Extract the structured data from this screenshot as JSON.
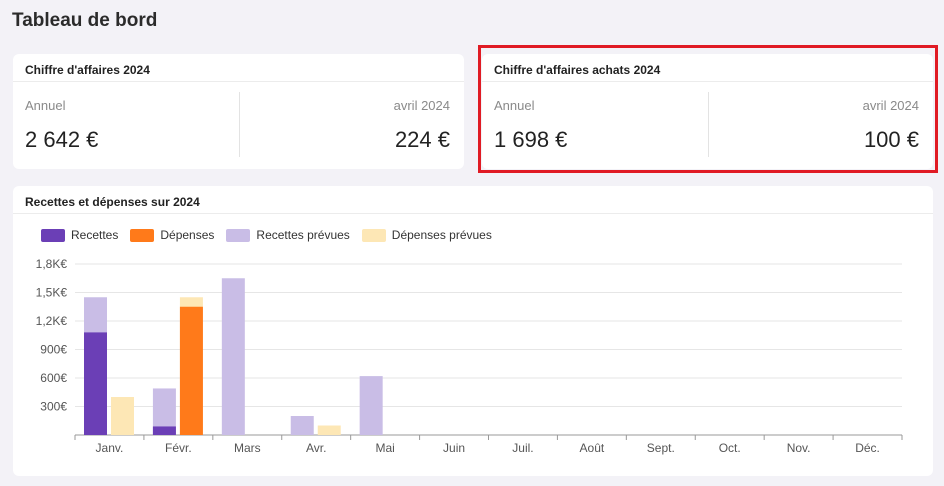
{
  "page": {
    "title": "Tableau de bord"
  },
  "revenue_card": {
    "title": "Chiffre d'affaires 2024",
    "annual_label": "Annuel",
    "annual_value": "2 642 €",
    "month_label": "avril 2024",
    "month_value": "224 €"
  },
  "purchases_card": {
    "title": "Chiffre d'affaires achats 2024",
    "annual_label": "Annuel",
    "annual_value": "1 698 €",
    "month_label": "avril 2024",
    "month_value": "100 €"
  },
  "chart_card": {
    "title": "Recettes et dépenses sur 2024"
  },
  "colors": {
    "recettes": "#6b3fb6",
    "depenses": "#ff7a1a",
    "recettes_prevues": "#c9bde6",
    "depenses_prevues": "#fde7b5",
    "highlight": "#e01b24"
  },
  "chart_data": {
    "type": "bar",
    "title": "Recettes et dépenses sur 2024",
    "categories": [
      "Janv.",
      "Févr.",
      "Mars",
      "Avr.",
      "Mai",
      "Juin",
      "Juil.",
      "Août",
      "Sept.",
      "Oct.",
      "Nov.",
      "Déc."
    ],
    "series": [
      {
        "name": "Recettes",
        "values": [
          1080,
          90,
          0,
          0,
          0,
          0,
          0,
          0,
          0,
          0,
          0,
          0
        ]
      },
      {
        "name": "Dépenses",
        "values": [
          0,
          1350,
          0,
          0,
          0,
          0,
          0,
          0,
          0,
          0,
          0,
          0
        ]
      },
      {
        "name": "Recettes prévues",
        "values": [
          1450,
          490,
          1650,
          200,
          620,
          0,
          0,
          0,
          0,
          0,
          0,
          0
        ]
      },
      {
        "name": "Dépenses prévues",
        "values": [
          400,
          1450,
          0,
          100,
          0,
          0,
          0,
          0,
          0,
          0,
          0,
          0
        ]
      }
    ],
    "yticks": [
      "300€",
      "600€",
      "900€",
      "1,2K€",
      "1,5K€",
      "1,8K€"
    ],
    "ytick_values": [
      300,
      600,
      900,
      1200,
      1500,
      1800
    ],
    "ylim": [
      0,
      1800
    ],
    "grid": true,
    "legend": "top-left"
  }
}
